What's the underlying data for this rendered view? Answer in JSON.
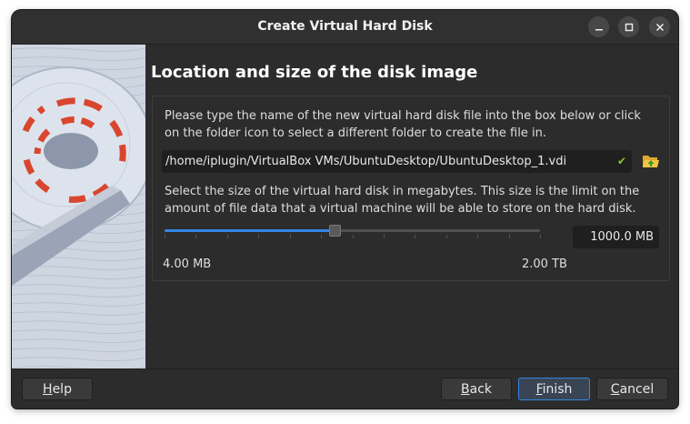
{
  "window": {
    "title": "Create Virtual Hard Disk",
    "controls": [
      "minimize-icon",
      "maximize-icon",
      "close-icon"
    ]
  },
  "page": {
    "heading": "Location and size of the disk image",
    "location_desc_line1": "Please type the name of the new virtual hard disk file into the box below or click",
    "location_desc_line2": "on the folder icon to select a different folder to create the file in.",
    "path_value": "/home/iplugin/VirtualBox VMs/UbuntuDesktop/UbuntuDesktop_1.vdi",
    "path_valid_icon": "checkmark-icon",
    "folder_icon": "folder-open-icon",
    "size_desc_line1": "Select the size of the virtual hard disk in megabytes. This size is the limit on the",
    "size_desc_line2": "amount of file data that a virtual machine will be able to store on the hard disk.",
    "size_value": "1000.0 MB",
    "slider_min_label": "4.00 MB",
    "slider_max_label": "2.00 TB",
    "slider_fraction": 0.45
  },
  "buttons": {
    "help_u": "H",
    "help_rest": "elp",
    "back_u": "B",
    "back_rest": "ack",
    "finish_u": "F",
    "finish_rest": "inish",
    "cancel_u": "C",
    "cancel_rest": "ancel"
  },
  "colors": {
    "accent": "#3584e4",
    "valid": "#7ecf2a",
    "window_bg": "#2c2c2c"
  }
}
